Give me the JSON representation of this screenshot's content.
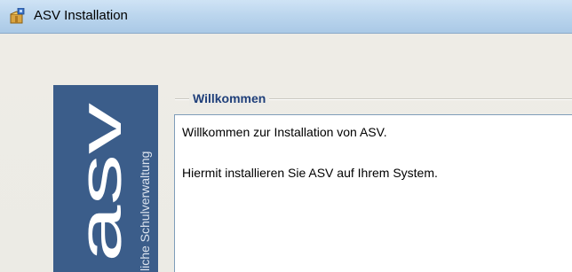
{
  "window": {
    "title": "ASV Installation",
    "icon": "installer-package-icon"
  },
  "logo": {
    "letters": "asv",
    "tagline": "liche Schulverwaltung",
    "background": "#3b5d8a"
  },
  "group": {
    "legend": "Willkommen",
    "legend_color": "#1f3f7a"
  },
  "welcome_text": {
    "line1": "Willkommen zur Installation von ASV.",
    "line2": "Hiermit installieren Sie ASV auf Ihrem System."
  }
}
